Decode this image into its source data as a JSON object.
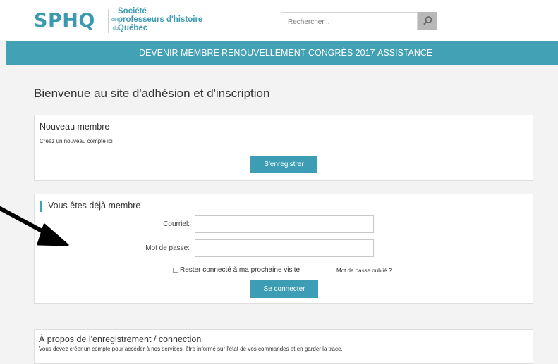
{
  "brand": {
    "logo": "SPHQ",
    "line1": "Société",
    "line2_prefix": "des",
    "line2": "professeurs d'histoire",
    "line3_prefix": "du",
    "line3": "Québec"
  },
  "search": {
    "placeholder": "Rechercher..."
  },
  "icons": {
    "search": "search-icon",
    "arrow": "arrow-icon",
    "checkbox": "checkbox-icon"
  },
  "nav": {
    "items": [
      {
        "label": "DEVENIR MEMBRE"
      },
      {
        "label": "RENOUVELLEMENT"
      },
      {
        "label": "CONGRÈS 2017"
      },
      {
        "label": "ASSISTANCE"
      }
    ]
  },
  "page": {
    "title": "Bienvenue au site d'adhésion et d'inscription"
  },
  "new_member": {
    "heading": "Nouveau membre",
    "text": "Créez un nouveau compte ici",
    "button": "S'enregistrer"
  },
  "login": {
    "heading": "Vous êtes déjà membre",
    "email_label": "Courriel:",
    "email_value": "",
    "password_label": "Mot de passe:",
    "password_value": "",
    "remember_label": "Rester connecté à ma prochaine visite.",
    "remember_checked": false,
    "forgot_link": "Mot de passe oublié ?",
    "button": "Se connecter"
  },
  "about": {
    "heading": "À propos de l'enregistrement / connection",
    "text": "Vous devez créer un compte pour accéder à nos services, être informé sur l'état de vos commandes et en garder la trace."
  },
  "colors": {
    "accent": "#43a1b6",
    "button": "#3c9db4",
    "brand": "#3b9ab2",
    "background": "#f3f3f3"
  }
}
